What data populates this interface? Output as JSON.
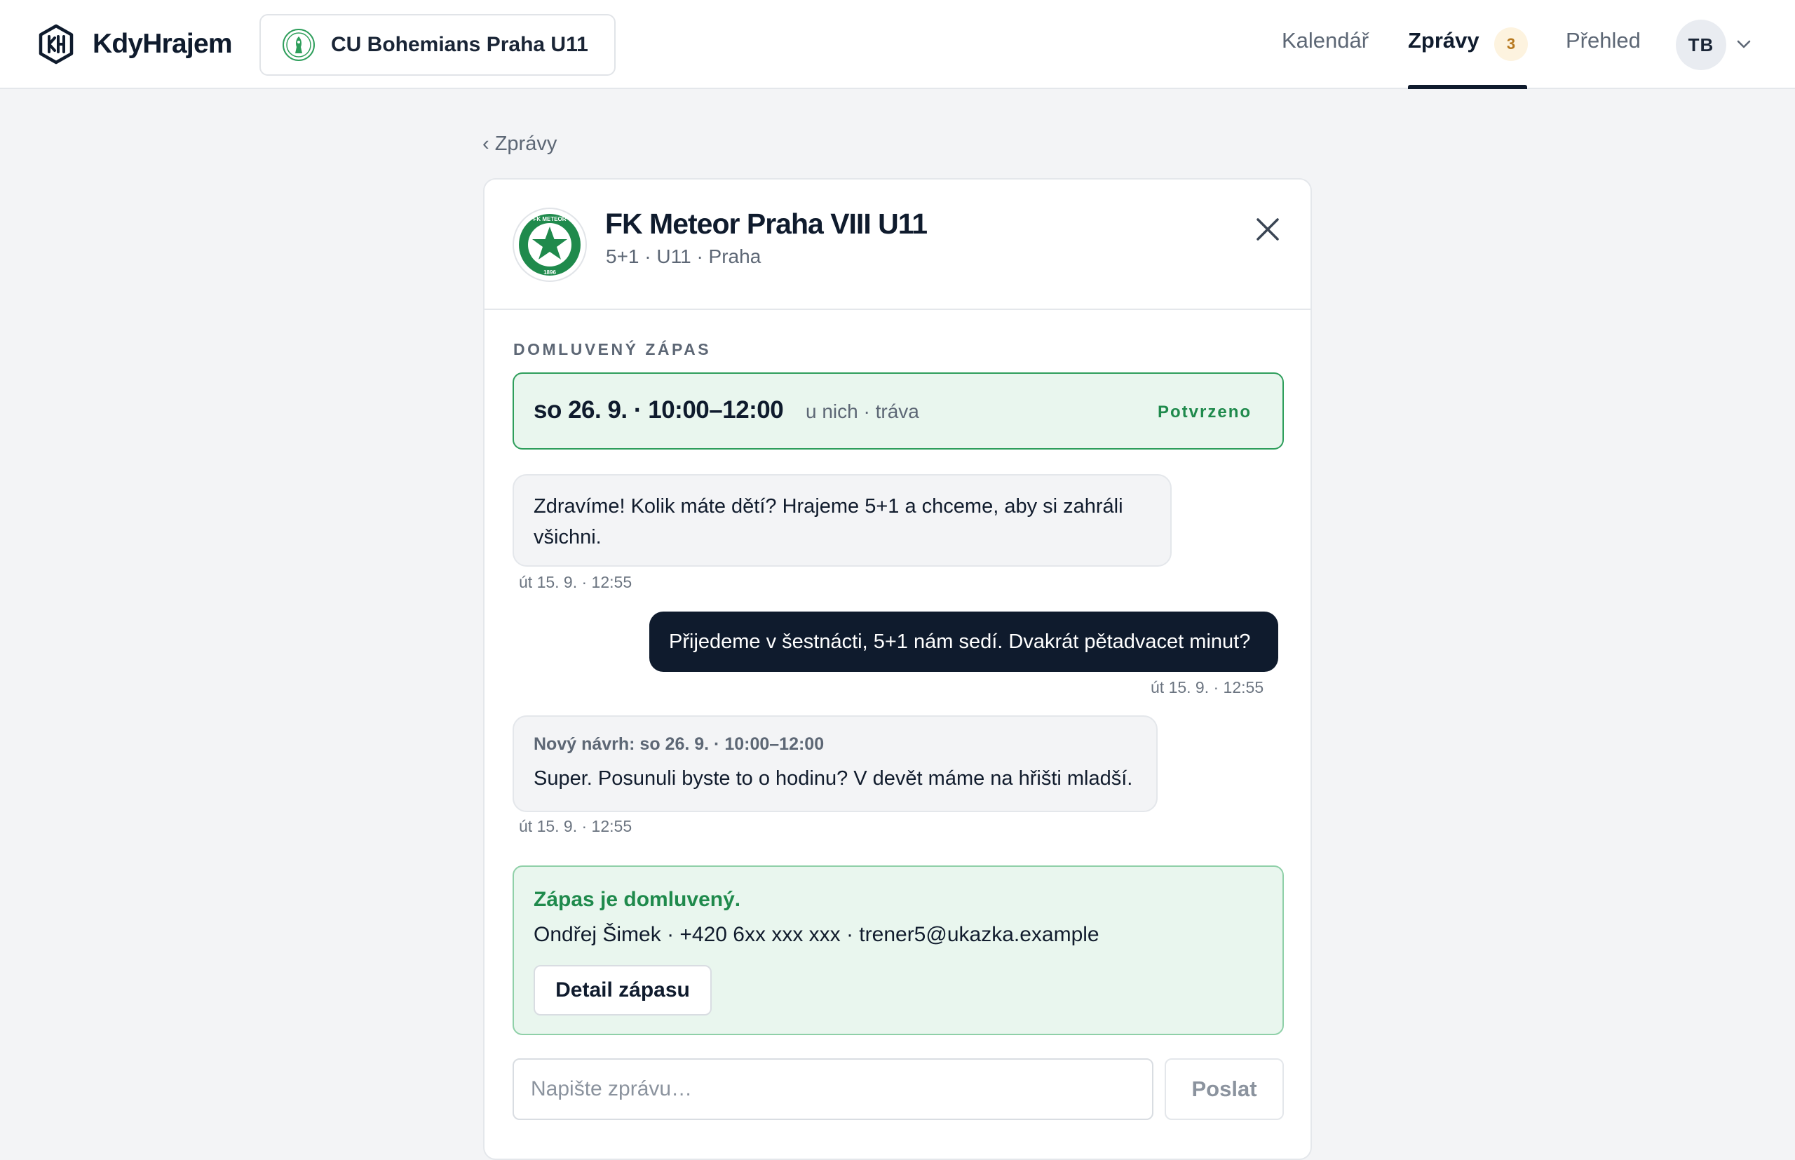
{
  "app": {
    "name": "KdyHrajem"
  },
  "club": {
    "name": "CU Bohemians Praha U11"
  },
  "nav": {
    "calendar": "Kalendář",
    "messages": "Zprávy",
    "messages_badge": "3",
    "overview": "Přehled",
    "user_initials": "TB",
    "active": "messages"
  },
  "back": {
    "label": "‹ Zprávy"
  },
  "conversation": {
    "opponent_name": "FK Meteor Praha VIII U11",
    "opponent_meta": "5+1 · U11 · Praha",
    "opponent_crest_text": "FK METEOR PRAHA VIII · 1896"
  },
  "agreed": {
    "section_label": "DOMLUVENÝ ZÁPAS",
    "datetime": "so 26. 9. · 10:00–12:00",
    "place": "u nich · tráva",
    "status": "Potvrzeno"
  },
  "messages": [
    {
      "direction": "incoming",
      "text": "Zdravíme! Kolik máte dětí? Hrajeme 5+1 a chceme, aby si zahráli všichni.",
      "time": "út 15. 9. · 12:55"
    },
    {
      "direction": "outgoing",
      "text": "Přijedeme v šestnácti, 5+1 nám sedí. Dvakrát pětadvacet minut?",
      "time": "út 15. 9. · 12:55"
    },
    {
      "direction": "incoming",
      "proposal": "Nový návrh: so 26. 9. · 10:00–12:00",
      "text": "Super. Posunuli byste to o hodinu? V devět máme na hřišti mladší.",
      "time": "út 15. 9. · 12:55"
    }
  ],
  "confirmation": {
    "title": "Zápas je domluvený.",
    "contact": "Ondřej Šimek · +420 6xx xxx xxx · trener5@ukazka.example",
    "detail_button": "Detail zápasu"
  },
  "composer": {
    "placeholder": "Napište zprávu…",
    "value": "",
    "send_label": "Poslat"
  },
  "colors": {
    "primary": "#0f1b2d",
    "success": "#1f8a4c",
    "success_bg": "#e9f6ee",
    "badge_bg": "#fdf3df",
    "badge_text": "#b7791f"
  }
}
